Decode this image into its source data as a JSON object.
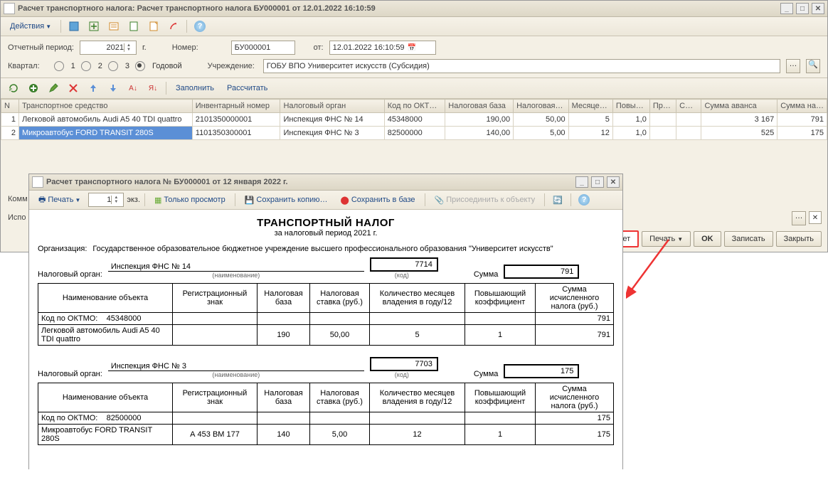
{
  "main": {
    "title": "Расчет транспортного налога: Расчет транспортного налога БУ000001 от 12.01.2022 16:10:59",
    "actions_label": "Действия",
    "form": {
      "period_label": "Отчетный период:",
      "year": "2021",
      "year_suffix": "г.",
      "number_label": "Номер:",
      "number": "БУ000001",
      "from_label": "от:",
      "date": "12.01.2022 16:10:59",
      "quarter_label": "Квартал:",
      "q1": "1",
      "q2": "2",
      "q3": "3",
      "qy": "Годовой",
      "org_label": "Учреждение:",
      "org": "ГОБУ ВПО Университет искусств (Субсидия)",
      "fill": "Заполнить",
      "calc": "Рассчитать"
    },
    "cols": {
      "n": "N",
      "veh": "Транспортное средство",
      "inv": "Инвентарный номер",
      "tax_org": "Налоговый орган",
      "okt": "Код по ОКТ…",
      "base": "Налоговая база",
      "rate": "Налоговая…",
      "months": "Месяце…",
      "coef": "Повы…",
      "pr": "Пр…",
      "c": "С…",
      "advance": "Сумма аванса",
      "total": "Сумма на…"
    },
    "rows": [
      {
        "n": "1",
        "veh": "Легковой автомобиль Audi A5 40 TDI quattro",
        "inv": "2101350000001",
        "tax_org": "Инспекция ФНС № 14",
        "okt": "45348000",
        "base": "190,00",
        "rate": "50,00",
        "months": "5",
        "coef": "1,0",
        "pr": "",
        "c": "",
        "advance": "3 167",
        "total": "791"
      },
      {
        "n": "2",
        "veh": "Микроавтобус FORD TRANSIT 280S",
        "inv": "1101350300001",
        "tax_org": "Инспекция ФНС № 3",
        "okt": "82500000",
        "base": "140,00",
        "rate": "5,00",
        "months": "12",
        "coef": "1,0",
        "pr": "",
        "c": "",
        "advance": "525",
        "total": "175"
      }
    ],
    "komm_label": "Комм",
    "isp_label": "Испо",
    "buttons": {
      "raschet": "Расчет",
      "print": "Печать",
      "ok": "OK",
      "save": "Записать",
      "close": "Закрыть"
    }
  },
  "report_win": {
    "title": "Расчет транспортного налога № БУ000001 от 12 января 2022 г.",
    "tb": {
      "print": "Печать",
      "copies": "1",
      "copies_suffix": "экз.",
      "preview": "Только просмотр",
      "save_copy": "Сохранить копию…",
      "save_db": "Сохранить в базе",
      "attach": "Присоединить к объекту"
    },
    "heading": "ТРАНСПОРТНЫЙ НАЛОГ",
    "sub": "за налоговый период   2021 г.",
    "org_label": "Организация:",
    "org": "Государственное образовательное бюджетное учреждение высшего профессионального образования \"Университет искусств\"",
    "tax_org_label": "Налоговый орган:",
    "name_hint": "(наименование)",
    "code_hint": "(код)",
    "sum_label": "Сумма",
    "sections": [
      {
        "tax_org": "Инспекция ФНС № 14",
        "code": "7714",
        "sum": "791",
        "oktmo": "45348000",
        "rows": [
          {
            "name": "Легковой автомобиль Audi A5 40 TDI quattro",
            "reg": "",
            "base": "190",
            "rate": "50,00",
            "months": "5",
            "coef": "1",
            "total": "791"
          }
        ]
      },
      {
        "tax_org": "Инспекция ФНС № 3",
        "code": "7703",
        "sum": "175",
        "oktmo": "82500000",
        "rows": [
          {
            "name": "Микроавтобус FORD TRANSIT 280S",
            "reg": "А 453 ВМ 177",
            "base": "140",
            "rate": "5,00",
            "months": "12",
            "coef": "1",
            "total": "175"
          }
        ]
      }
    ],
    "table_hdr": {
      "name": "Наименование объекта",
      "reg": "Регистрационный знак",
      "base": "Налоговая база",
      "rate": "Налоговая ставка (руб.)",
      "months": "Количество месяцев владения в году/12",
      "coef": "Повышающий коэффициент",
      "total": "Сумма исчисленного налога (руб.)",
      "oktmo": "Код по ОКТМО:"
    }
  }
}
